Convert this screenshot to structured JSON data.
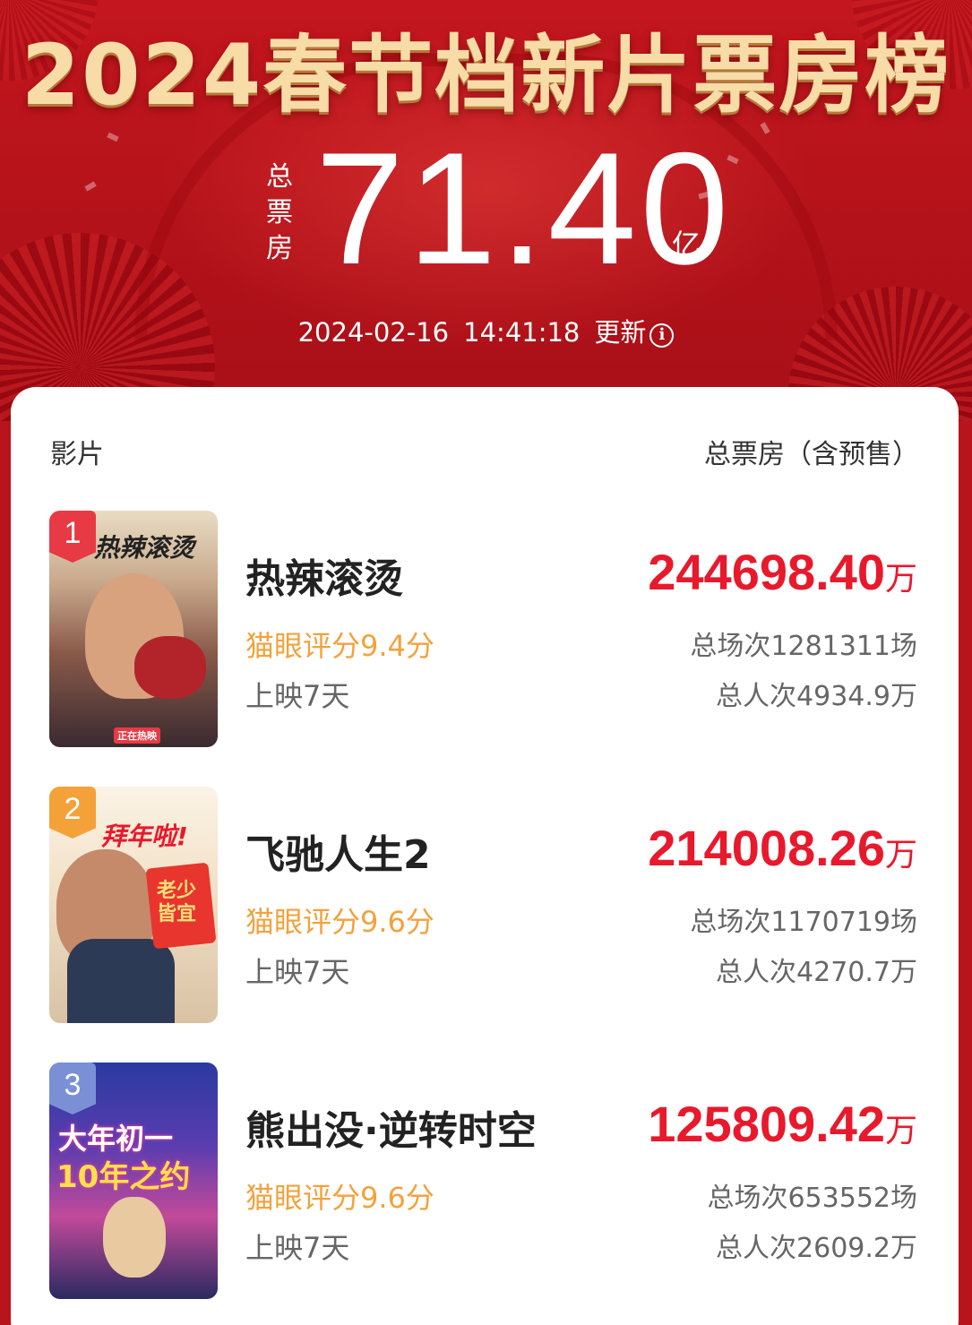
{
  "header": {
    "title": "2024春节档新片票房榜",
    "total_label_chars": [
      "总",
      "票",
      "房"
    ],
    "total_value": "71.40",
    "total_unit": "亿",
    "update_date": "2024-02-16",
    "update_time": "14:41:18",
    "update_label": "更新",
    "info_icon": "info-icon"
  },
  "table": {
    "col_film": "影片",
    "col_box": "总票房（含预售）"
  },
  "movies": [
    {
      "rank": "1",
      "name": "热辣滚烫",
      "rating": "猫眼评分9.4分",
      "days": "上映7天",
      "gross": "244698.40",
      "gross_unit": "万",
      "shows": "总场次1281311场",
      "people": "总人次4934.9万",
      "poster_text": "热辣滚烫",
      "poster_sub": "正在热映"
    },
    {
      "rank": "2",
      "name": "飞驰人生2",
      "rating": "猫眼评分9.6分",
      "days": "上映7天",
      "gross": "214008.26",
      "gross_unit": "万",
      "shows": "总场次1170719场",
      "people": "总人次4270.7万",
      "poster_text": "拜年啦!",
      "poster_sub": "老少皆宜"
    },
    {
      "rank": "3",
      "name": "熊出没·逆转时空",
      "rating": "猫眼评分9.6分",
      "days": "上映7天",
      "gross": "125809.42",
      "gross_unit": "万",
      "shows": "总场次653552场",
      "people": "总人次2609.2万",
      "poster_text": "大年初一",
      "poster_sub": "10年之约"
    }
  ],
  "colors": {
    "header_red": "#c4161e",
    "gold_title": "#f7dca8",
    "gross_red": "#e8192c",
    "rating_orange": "#f2a23c",
    "rank1": "#e83a44",
    "rank2": "#f5a13a",
    "rank3": "#7b8fd6"
  }
}
